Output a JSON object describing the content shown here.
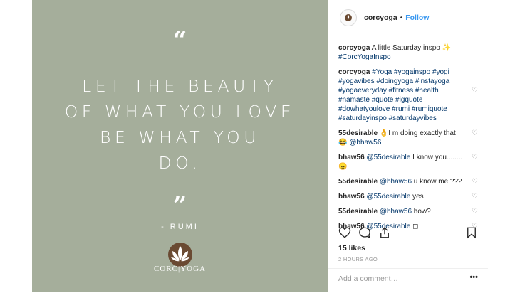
{
  "photo": {
    "quote_lines": [
      "LET THE BEAUTY",
      "OF WHAT YOU LOVE",
      "BE WHAT YOU",
      "DO."
    ],
    "author": "- RUMI",
    "logo_text": "CORC|YOGA"
  },
  "header": {
    "username": "corcyoga",
    "separator": "•",
    "follow_label": "Follow"
  },
  "comments": [
    {
      "user": "corcyoga",
      "text": "A little Saturday inspo ✨ ",
      "tags": "#CorcYogaInspo",
      "heart": false
    },
    {
      "user": "corcyoga",
      "text": "",
      "tags": "#Yoga #yogainspo #yogi #yogavibes #doingyoga #instayoga #yogaeveryday #fitness #health #namaste #quote #igquote #dowhatyoulove #rumi #rumiquote #saturdayinspo #saturdayvibes",
      "heart": true
    },
    {
      "user": "55desirable",
      "text": "👌I m doing exactly that😂 ",
      "tags": "@bhaw56",
      "heart": true
    },
    {
      "user": "bhaw56",
      "text": "",
      "tags": "@55desirable",
      "text2": " I know you........ 😠",
      "heart": true
    },
    {
      "user": "55desirable",
      "text": "",
      "tags": "@bhaw56",
      "text2": " u know me ???",
      "heart": true
    },
    {
      "user": "bhaw56",
      "text": "",
      "tags": "@55desirable",
      "text2": " yes",
      "heart": true
    },
    {
      "user": "55desirable",
      "text": "",
      "tags": "@bhaw56",
      "text2": " how?",
      "heart": true
    },
    {
      "user": "bhaw56",
      "text": "",
      "tags": "@55desirable",
      "text2": " ◻",
      "heart": true
    }
  ],
  "likes": "15 likes",
  "timestamp": "2 HOURS AGO",
  "add_comment": {
    "placeholder": "Add a comment…",
    "more": "•••"
  },
  "icons": {
    "heart": "heart-icon",
    "comment": "comment-icon",
    "share": "share-icon",
    "save": "bookmark-icon"
  },
  "colors": {
    "photo_bg": "#a5ae9b",
    "link": "#003569",
    "follow": "#3897f0"
  }
}
